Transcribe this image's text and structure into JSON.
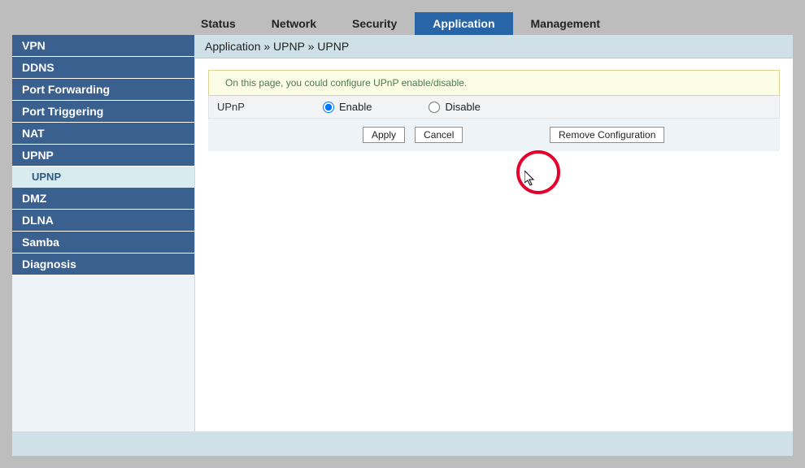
{
  "topTabs": {
    "status": "Status",
    "network": "Network",
    "security": "Security",
    "application": "Application",
    "management": "Management"
  },
  "sidebar": {
    "vpn": "VPN",
    "ddns": "DDNS",
    "portForwarding": "Port Forwarding",
    "portTriggering": "Port Triggering",
    "nat": "NAT",
    "upnp": "UPNP",
    "upnpSub": "UPNP",
    "dmz": "DMZ",
    "dlna": "DLNA",
    "samba": "Samba",
    "diagnosis": "Diagnosis"
  },
  "breadcrumb": "Application » UPNP » UPNP",
  "infoText": "On this page, you could configure UPnP enable/disable.",
  "form": {
    "label": "UPnP",
    "enable": "Enable",
    "disable": "Disable"
  },
  "buttons": {
    "apply": "Apply",
    "cancel": "Cancel",
    "remove": "Remove Configuration"
  }
}
